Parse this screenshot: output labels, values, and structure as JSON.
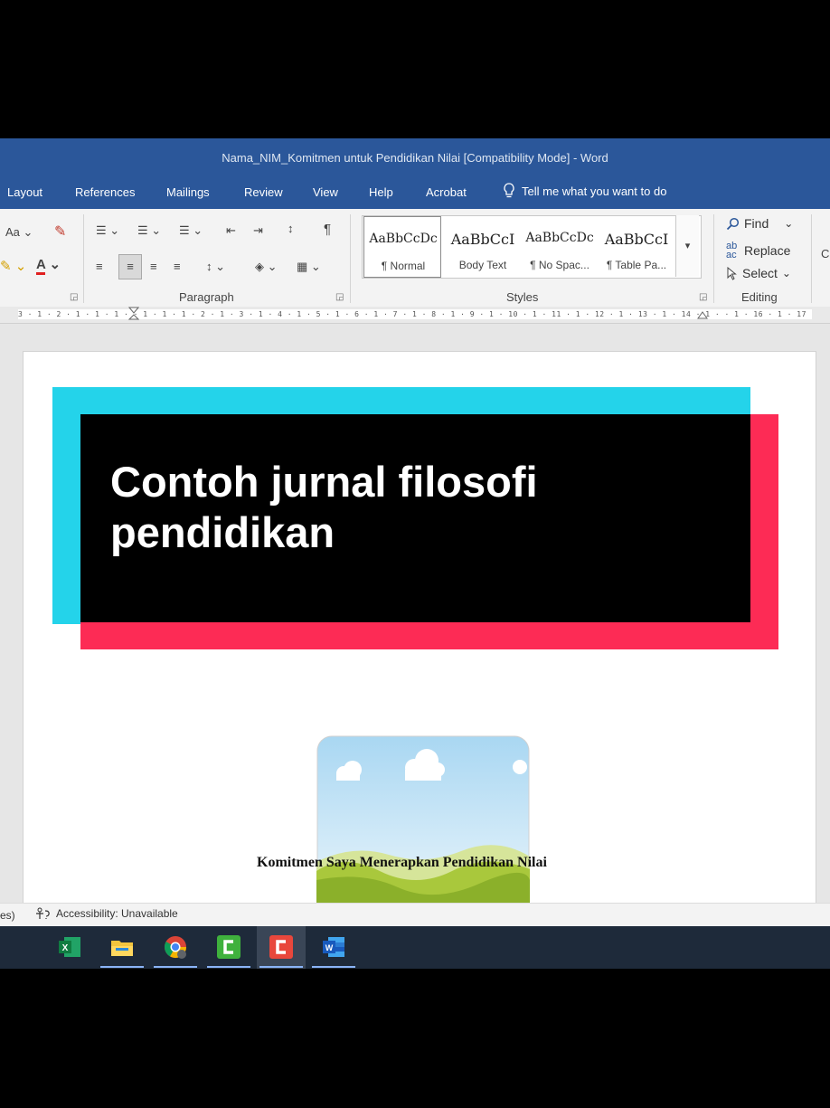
{
  "window": {
    "title": "Nama_NIM_Komitmen untuk Pendidikan Nilai [Compatibility Mode]  -  Word"
  },
  "menu": {
    "tabs": [
      "Layout",
      "References",
      "Mailings",
      "Review",
      "View",
      "Help",
      "Acrobat"
    ],
    "tell_me": "Tell me what you want to do"
  },
  "ribbon": {
    "font": {
      "aa_label": "Aa",
      "font_color_label": "A"
    },
    "paragraph_label": "Paragraph",
    "styles_label": "Styles",
    "editing_label": "Editing",
    "styles": [
      {
        "sample": "AaBbCcDc",
        "name": "¶ Normal"
      },
      {
        "sample": "AaBbCcI",
        "name": "Body Text"
      },
      {
        "sample": "AaBbCcDc",
        "name": "¶ No Spac..."
      },
      {
        "sample": "AaBbCcI",
        "name": "¶ Table Pa..."
      }
    ],
    "editing": {
      "find": "Find",
      "replace": "Replace",
      "select": "Select"
    }
  },
  "ruler": {
    "scale": "3 · 1 · 2 · 1 · 1 · 1 ·   · 1 · 1 · 1 · 2 · 1 · 3 · 1 · 4 · 1 · 5 · 1 · 6 · 1 · 7 · 1 · 8 · 1 · 9 · 1 · 10 · 1 · 11 · 1 · 12 · 1 · 13 · 1 · 14 · 1 ·   · 1 · 16 · 1 · 17 · 1 ·"
  },
  "document": {
    "heading": "Komitmen Saya Menerapkan Pendidikan Nilai"
  },
  "statusbar": {
    "left_fragment": "es)",
    "accessibility": "Accessibility: Unavailable"
  },
  "overlay": {
    "caption": "Contoh jurnal filosofi pendidikan"
  },
  "colors": {
    "word_blue": "#2b579a",
    "overlay_cyan": "#24d3ea",
    "overlay_red": "#fd2b55"
  },
  "taskbar": {
    "apps": [
      "excel-icon",
      "file-explorer-icon",
      "chrome-icon",
      "camtasia-green-icon",
      "camtasia-red-icon",
      "word-icon"
    ]
  }
}
